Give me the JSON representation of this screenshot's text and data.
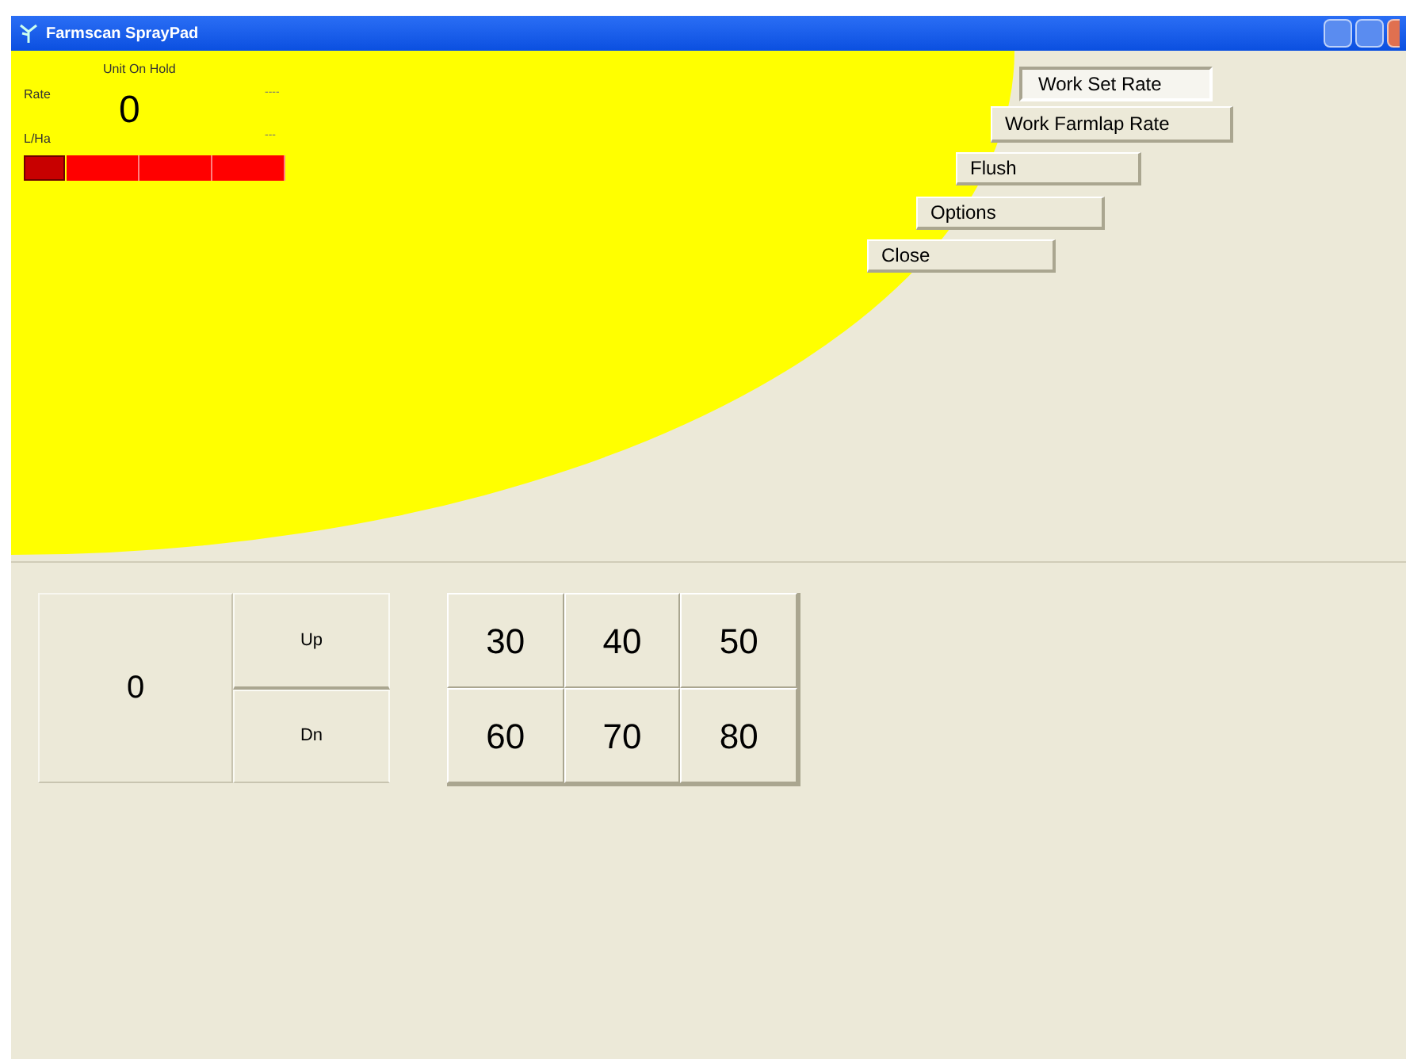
{
  "window": {
    "title": "Farmscan SprayPad"
  },
  "status": {
    "mode": "Unit On Hold",
    "rate_label": "Rate",
    "value": "0",
    "unit_label": "L/Ha",
    "dash_1": "----",
    "dash_2": "---",
    "segments": [
      {
        "on": true
      },
      {
        "on": false
      },
      {
        "on": false
      },
      {
        "on": false
      }
    ]
  },
  "buttons": [
    {
      "label": "Work Set Rate",
      "selected": true
    },
    {
      "label": "Work Farmlap Rate",
      "selected": false
    },
    {
      "label": "Flush",
      "selected": false
    },
    {
      "label": "Options",
      "selected": false
    },
    {
      "label": "Close",
      "selected": false
    }
  ],
  "adjust": {
    "value": "0",
    "up": "Up",
    "down": "Dn"
  },
  "presets": [
    "30",
    "40",
    "50",
    "60",
    "70",
    "80"
  ]
}
